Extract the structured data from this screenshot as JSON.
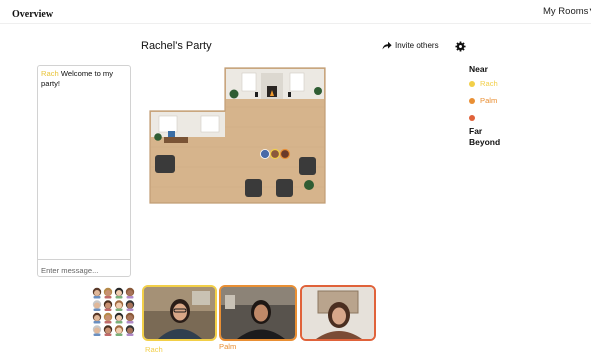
{
  "nav": {
    "overview": "Overview",
    "my_rooms": "My Rooms"
  },
  "room": {
    "title": "Rachel's Party",
    "invite_label": "Invite others"
  },
  "chat": {
    "messages": [
      {
        "author": "Rach",
        "text": "Welcome to my party!"
      }
    ],
    "input_placeholder": "Enter message..."
  },
  "proximity": {
    "near_label": "Near",
    "far_label": "Far",
    "beyond_label": "Beyond",
    "people": [
      {
        "name": "Rach",
        "color": "#f2cf48"
      },
      {
        "name": "Palm",
        "color": "#e98f34"
      },
      {
        "name": "",
        "color": "#e0623a"
      }
    ]
  },
  "videos": [
    {
      "name": "Rach",
      "border_color": "#f2cf48"
    },
    {
      "name": "Palm",
      "border_color": "#e98f34"
    },
    {
      "name": "",
      "border_color": "#e0623a"
    }
  ],
  "colors": {
    "rach": "#f2cf48",
    "palm": "#e98f34",
    "third": "#e0623a",
    "floor": "#d6b48c"
  },
  "icons": {
    "invite": "share-arrow-icon",
    "settings": "gear-icon",
    "my_rooms_caret": "caret-down-icon"
  }
}
